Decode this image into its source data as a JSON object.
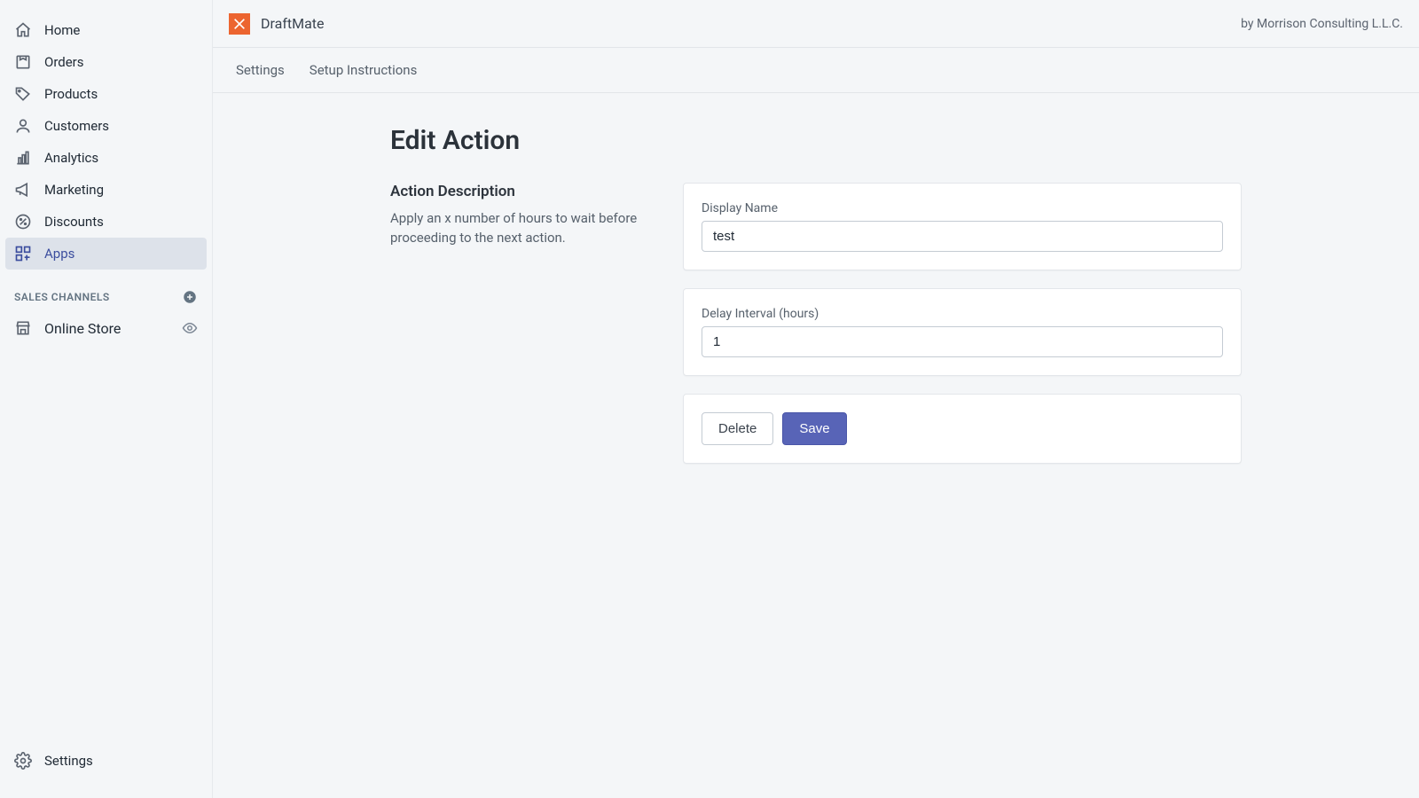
{
  "sidebar": {
    "items": [
      {
        "label": "Home"
      },
      {
        "label": "Orders"
      },
      {
        "label": "Products"
      },
      {
        "label": "Customers"
      },
      {
        "label": "Analytics"
      },
      {
        "label": "Marketing"
      },
      {
        "label": "Discounts"
      },
      {
        "label": "Apps"
      }
    ],
    "section_header": "SALES CHANNELS",
    "channels": [
      {
        "label": "Online Store"
      }
    ],
    "settings_label": "Settings"
  },
  "header": {
    "app_name": "DraftMate",
    "byline": "by Morrison Consulting L.L.C."
  },
  "subnav": {
    "items": [
      {
        "label": "Settings"
      },
      {
        "label": "Setup Instructions"
      }
    ]
  },
  "page": {
    "title": "Edit Action",
    "section_title": "Action Description",
    "section_desc": "Apply an x number of hours to wait before proceeding to the next action.",
    "display_name_label": "Display Name",
    "display_name_value": "test",
    "delay_label": "Delay Interval (hours)",
    "delay_value": "1",
    "delete_label": "Delete",
    "save_label": "Save"
  }
}
